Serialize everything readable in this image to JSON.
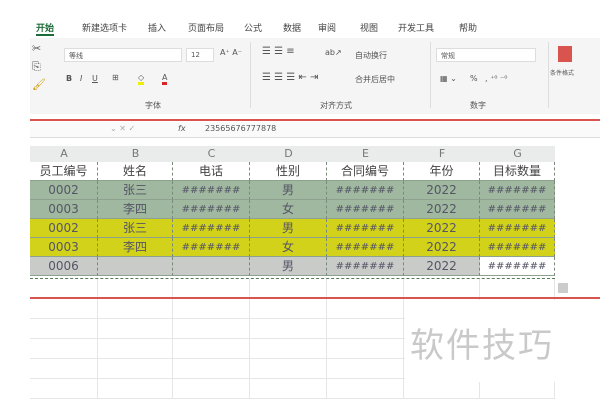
{
  "tabs": [
    "开始",
    "新建选项卡",
    "插入",
    "页面布局",
    "公式",
    "数据",
    "审阅",
    "视图",
    "开发工具",
    "帮助"
  ],
  "ribbon": {
    "font_name": "等线",
    "font_size": "12",
    "wrap_text": "自动换行",
    "merge_center": "合并后居中",
    "number_format": "常规",
    "conditional_format": "条件格式",
    "groups": {
      "font": "字体",
      "align": "对齐方式",
      "number": "数字"
    },
    "bold": "B",
    "italic": "I",
    "underline": "U",
    "percent": "%"
  },
  "formula_bar": {
    "value": "23565676777878",
    "fx": "fx"
  },
  "columns": [
    "A",
    "B",
    "C",
    "D",
    "E",
    "F",
    "G"
  ],
  "headers": [
    "员工编号",
    "姓名",
    "电话",
    "性别",
    "合同编号",
    "年份",
    "目标数量"
  ],
  "rows": [
    [
      "0002",
      "张三",
      "#######",
      "男",
      "#######",
      "2022",
      "#######"
    ],
    [
      "0003",
      "李四",
      "#######",
      "女",
      "#######",
      "2022",
      "#######"
    ],
    [
      "0002",
      "张三",
      "#######",
      "男",
      "#######",
      "2022",
      "#######"
    ],
    [
      "0003",
      "李四",
      "#######",
      "女",
      "#######",
      "2022",
      "#######"
    ],
    [
      "0006",
      "",
      "",
      "男",
      "#######",
      "2022",
      "#######"
    ]
  ],
  "row_colors": [
    "#9fb89f",
    "#9fb89f",
    "#d2d21a",
    "#d2d21a",
    "#c9cbc9"
  ],
  "watermark": "软件技巧"
}
